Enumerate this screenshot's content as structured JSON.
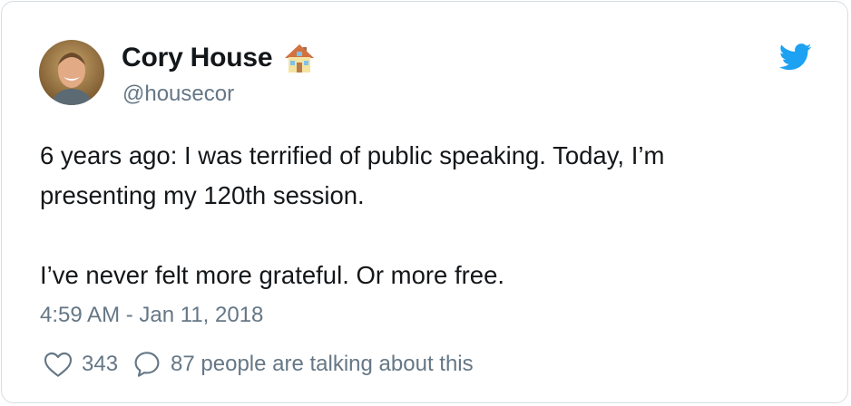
{
  "tweet": {
    "author": {
      "display_name": "Cory House",
      "handle": "@housecor",
      "avatar": "profile-photo",
      "name_emoji": "house-emoji"
    },
    "brand_icon": "twitter-bird-icon",
    "text_lines": [
      "6 years ago: I was terrified of public speaking. Today, I’m",
      "presenting my 120th session.",
      "I’ve never felt more grateful. Or more free."
    ],
    "timestamp": "4:59 AM - Jan 11, 2018",
    "likes": "343",
    "conversation": "87 people are talking about this"
  },
  "colors": {
    "text": "#14171a",
    "secondary": "#657786",
    "twitter_blue": "#1da1f2",
    "border": "#d7dde2"
  }
}
